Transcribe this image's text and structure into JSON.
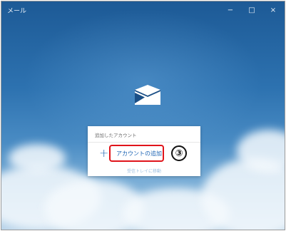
{
  "window": {
    "title": "メール",
    "minimize_label": "−",
    "maximize_label": "□",
    "close_label": "×"
  },
  "panel": {
    "header": "追加したアカウント",
    "add_account_label": "アカウントの追加",
    "plus_symbol": "+",
    "secondary_link": "受信トレイに移動"
  },
  "annotation": {
    "step": "③",
    "highlight_color": "#e0141a"
  },
  "colors": {
    "accent": "#1f66b5",
    "sky_top": "#1d5a96",
    "sky_bottom": "#b9d4ea"
  }
}
